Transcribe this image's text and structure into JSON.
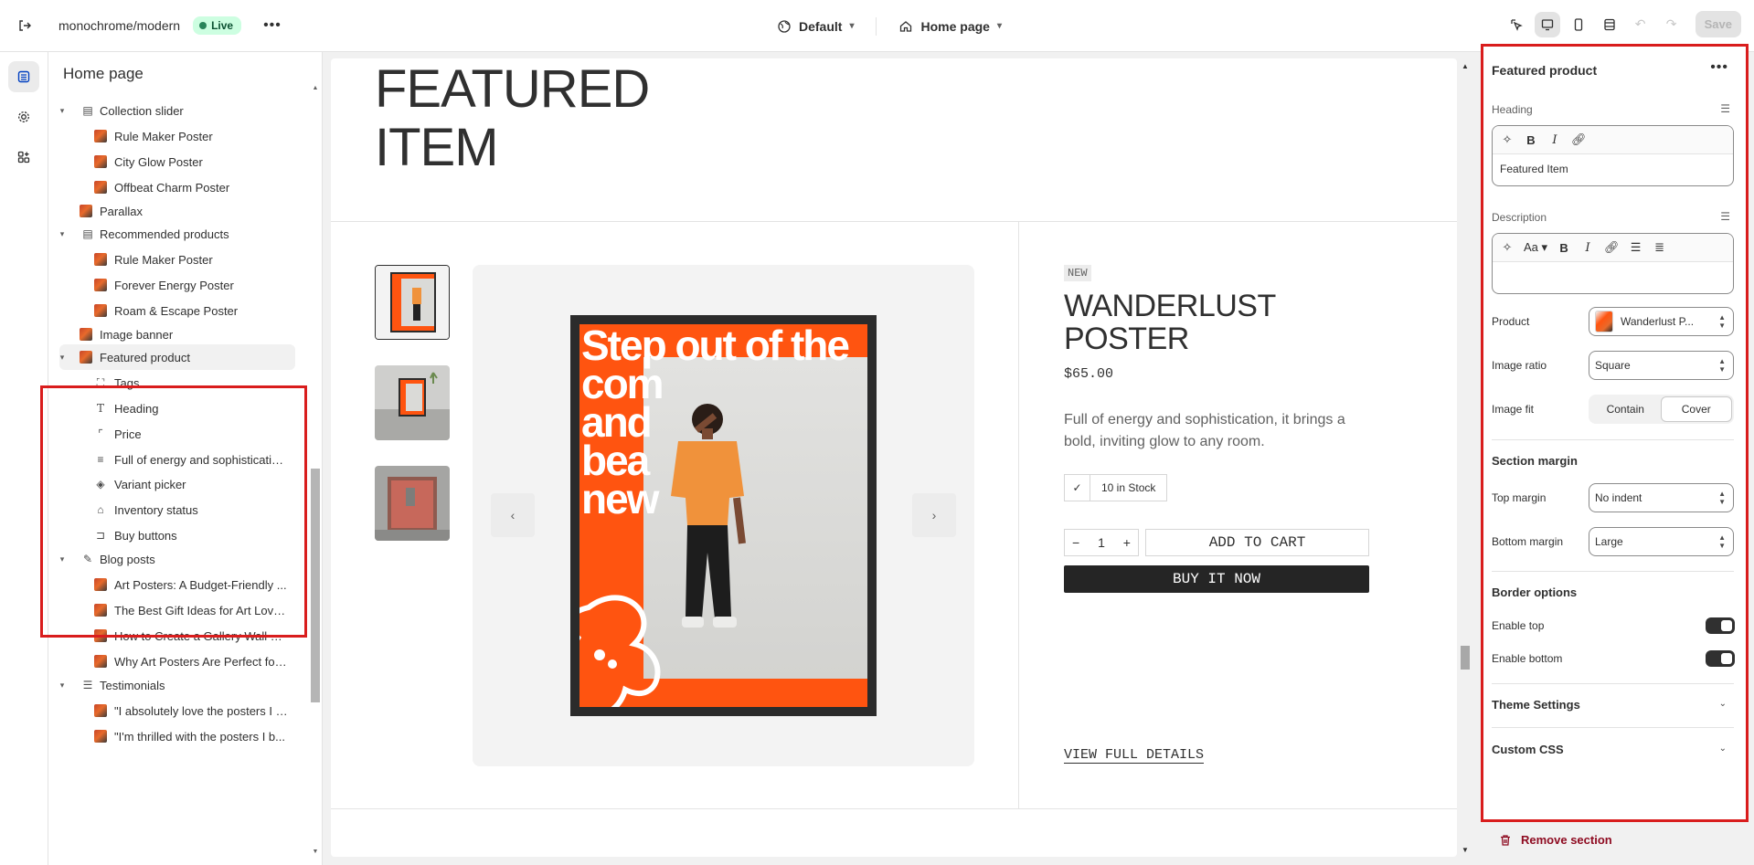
{
  "topbar": {
    "store_name": "monochrome/modern",
    "live_label": "Live",
    "theme_select": "Default",
    "page_select": "Home page",
    "save_label": "Save"
  },
  "sidebar": {
    "title": "Home page",
    "items": [
      {
        "label": "Collection slider"
      },
      {
        "label": "Rule Maker Poster"
      },
      {
        "label": "City Glow Poster"
      },
      {
        "label": "Offbeat Charm Poster"
      },
      {
        "label": "Parallax"
      },
      {
        "label": "Recommended products"
      },
      {
        "label": "Rule Maker Poster"
      },
      {
        "label": "Forever Energy Poster"
      },
      {
        "label": "Roam & Escape Poster"
      },
      {
        "label": "Image banner"
      },
      {
        "label": "Featured product"
      },
      {
        "label": "Tags"
      },
      {
        "label": "Heading"
      },
      {
        "label": "Price"
      },
      {
        "label": "Full of energy and sophisticatio..."
      },
      {
        "label": "Variant picker"
      },
      {
        "label": "Inventory status"
      },
      {
        "label": "Buy buttons"
      },
      {
        "label": "Blog posts"
      },
      {
        "label": "Art Posters: A Budget-Friendly ..."
      },
      {
        "label": "The Best Gift Ideas for Art Lovers"
      },
      {
        "label": "How to Create a Gallery Wall wit..."
      },
      {
        "label": "Why Art Posters Are Perfect for ..."
      },
      {
        "label": "Testimonials"
      },
      {
        "label": "\"I absolutely love the posters I o..."
      },
      {
        "label": "\"I'm thrilled with the posters I b..."
      }
    ]
  },
  "preview": {
    "featured_title_line1": "FEATURED",
    "featured_title_line2": "ITEM",
    "poster_text": [
      "Step out of the",
      "com",
      "and",
      "bea",
      "new"
    ],
    "badge": "NEW",
    "product_title_line1": "WANDERLUST",
    "product_title_line2": "POSTER",
    "price": "$65.00",
    "description": "Full of energy and sophistication, it brings a bold, inviting glow to any room.",
    "stock": "10 in Stock",
    "qty_minus": "−",
    "qty_value": "1",
    "qty_plus": "+",
    "add_to_cart": "ADD TO CART",
    "buy_now": "BUY IT NOW",
    "view_details": "VIEW FULL DETAILS"
  },
  "settings": {
    "title": "Featured product",
    "heading_label": "Heading",
    "heading_value": "Featured Item",
    "description_label": "Description",
    "description_value": "",
    "font_menu": "Aa",
    "product_label": "Product",
    "product_value": "Wanderlust P...",
    "image_ratio_label": "Image ratio",
    "image_ratio_value": "Square",
    "image_fit_label": "Image fit",
    "image_fit_options": [
      "Contain",
      "Cover"
    ],
    "image_fit_selected": "Cover",
    "section_margin": "Section margin",
    "top_margin_label": "Top margin",
    "top_margin_value": "No indent",
    "bottom_margin_label": "Bottom margin",
    "bottom_margin_value": "Large",
    "border_options": "Border options",
    "enable_top_label": "Enable top",
    "enable_top": true,
    "enable_bottom_label": "Enable bottom",
    "enable_bottom": true,
    "theme_settings": "Theme Settings",
    "custom_css": "Custom CSS",
    "remove_section": "Remove section"
  },
  "colors": {
    "highlight": "#d91d1d",
    "poster_orange": "#ff5410",
    "live_green": "#29845a",
    "remove_red": "#8e0b21"
  }
}
